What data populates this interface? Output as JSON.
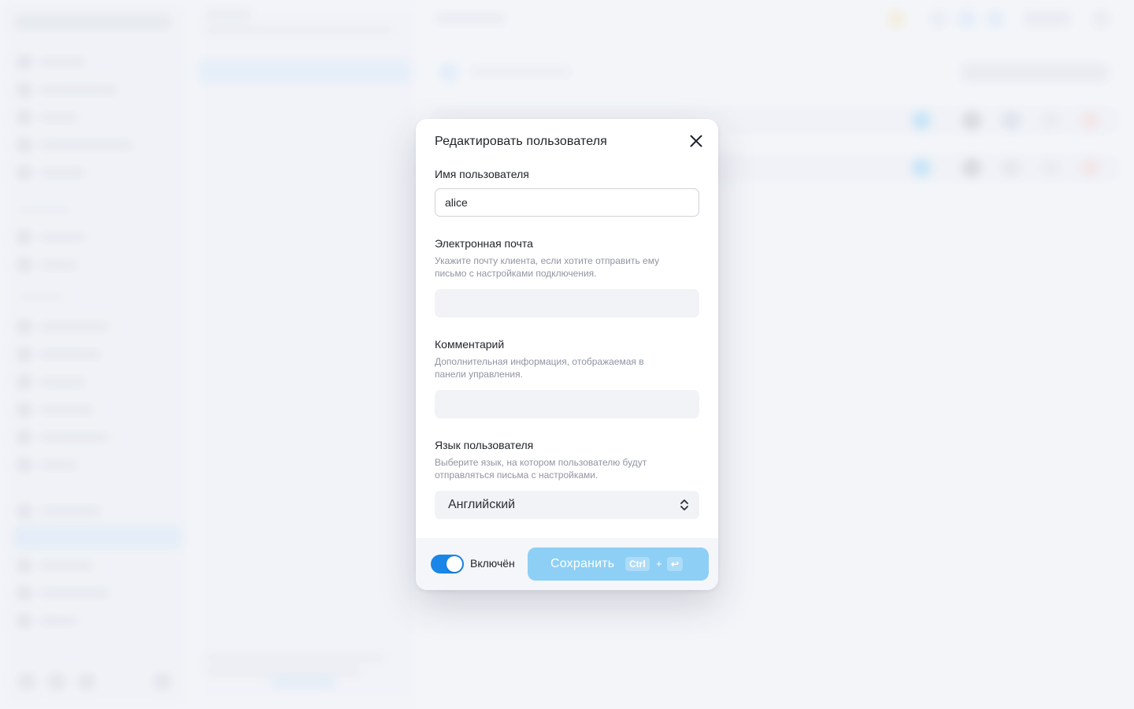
{
  "modal": {
    "title": "Редактировать пользователя",
    "username": {
      "label": "Имя пользователя",
      "value": "alice"
    },
    "email": {
      "label": "Электронная почта",
      "hint": "Укажите почту клиента, если хотите отправить ему письмо с настройками подключения.",
      "value": ""
    },
    "comment": {
      "label": "Комментарий",
      "hint": "Дополнительная информация, отображаемая в панели управления.",
      "value": ""
    },
    "language": {
      "label": "Язык пользователя",
      "hint": "Выберите язык, на котором пользователю будут отправляться письма с настройками.",
      "selected": "Английский"
    },
    "footer": {
      "enabled_label": "Включён",
      "enabled": true,
      "save_label": "Сохранить",
      "shortcut_ctrl": "Ctrl",
      "shortcut_plus": "+",
      "shortcut_enter": "↩"
    }
  },
  "colors": {
    "accent": "#1a86e8",
    "save_button": "#8ecff5"
  }
}
